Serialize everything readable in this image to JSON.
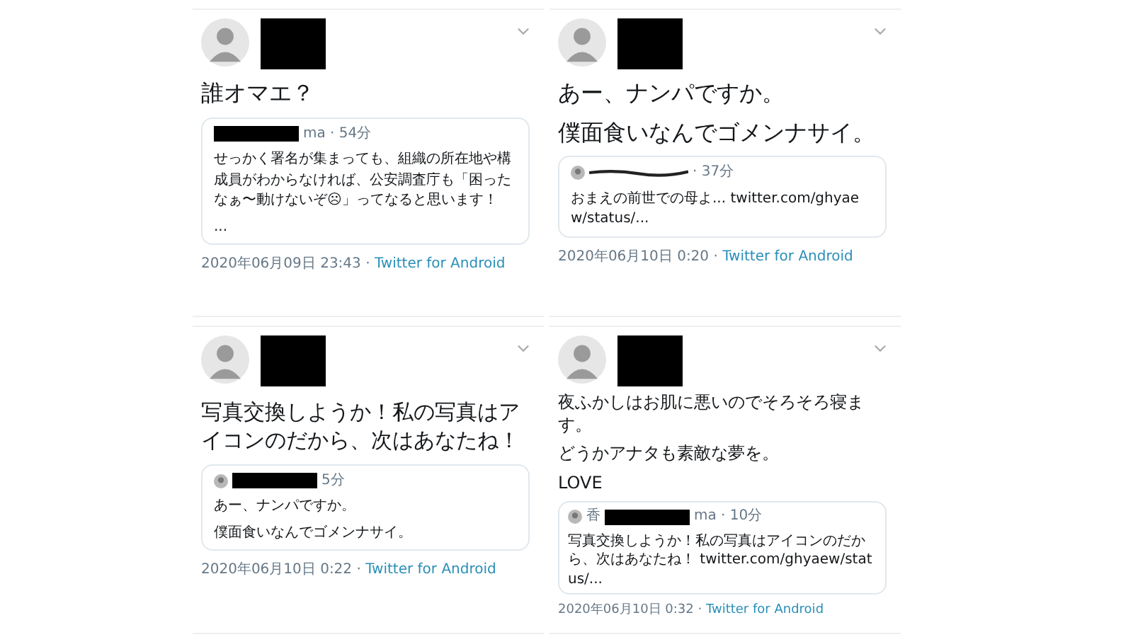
{
  "tweets": [
    {
      "body": [
        "誰オマエ？"
      ],
      "quote": {
        "meta": [
          {
            "kind": "redaction"
          },
          {
            "kind": "text",
            "text": "ma · 54分"
          }
        ],
        "paragraphs": [
          [
            {
              "kind": "text",
              "text": "せっかく署名が集まっても、組織の所在地や構成員がわからなければ、公安調査庁も「困ったなぁ〜動けないぞ☹」ってなると思います！"
            }
          ],
          [
            {
              "kind": "text",
              "text": "..."
            }
          ]
        ]
      },
      "date": "2020年06月09日 23:43 · ",
      "source": "Twitter for Android"
    },
    {
      "body": [
        "あー、ナンパですか。",
        "僕面食いなんでゴメンナサイ。"
      ],
      "quote": {
        "meta": [
          {
            "kind": "avatar"
          },
          {
            "kind": "scribble"
          },
          {
            "kind": "text",
            "text": "· 37分"
          }
        ],
        "paragraphs": [
          [
            {
              "kind": "text",
              "text": "おまえの前世での母よ... twitter.com/ghyaew/status/..."
            }
          ]
        ]
      },
      "date": "2020年06月10日 0:20 · ",
      "source": "Twitter for Android"
    },
    {
      "body": [
        "写真交換しようか！私の写真はアイコンのだから、次はあなたね！"
      ],
      "quote": {
        "meta": [
          {
            "kind": "avatar"
          },
          {
            "kind": "redaction"
          },
          {
            "kind": "text",
            "text": "5分"
          }
        ],
        "paragraphs": [
          [
            {
              "kind": "text",
              "text": "あー、ナンパですか。"
            }
          ],
          [
            {
              "kind": "text",
              "text": "僕面食いなんでゴメンナサイ。"
            }
          ]
        ]
      },
      "date": "2020年06月10日 0:22 · ",
      "source": "Twitter for Android"
    },
    {
      "body": [
        "夜ふかしはお肌に悪いのでそろそろ寝ます。",
        "どうかアナタも素敵な夢を。",
        "LOVE"
      ],
      "quote": {
        "meta": [
          {
            "kind": "avatar"
          },
          {
            "kind": "text",
            "text": "香"
          },
          {
            "kind": "redaction"
          },
          {
            "kind": "text",
            "text": "ma · 10分"
          }
        ],
        "paragraphs": [
          [
            {
              "kind": "text",
              "text": "写真交換しようか！私の写真はアイコンのだから、次はあなたね！ twitter.com/ghyaew/status/..."
            }
          ]
        ]
      },
      "date": "2020年06月10日 0:32 · ",
      "source": "Twitter for Android"
    }
  ]
}
